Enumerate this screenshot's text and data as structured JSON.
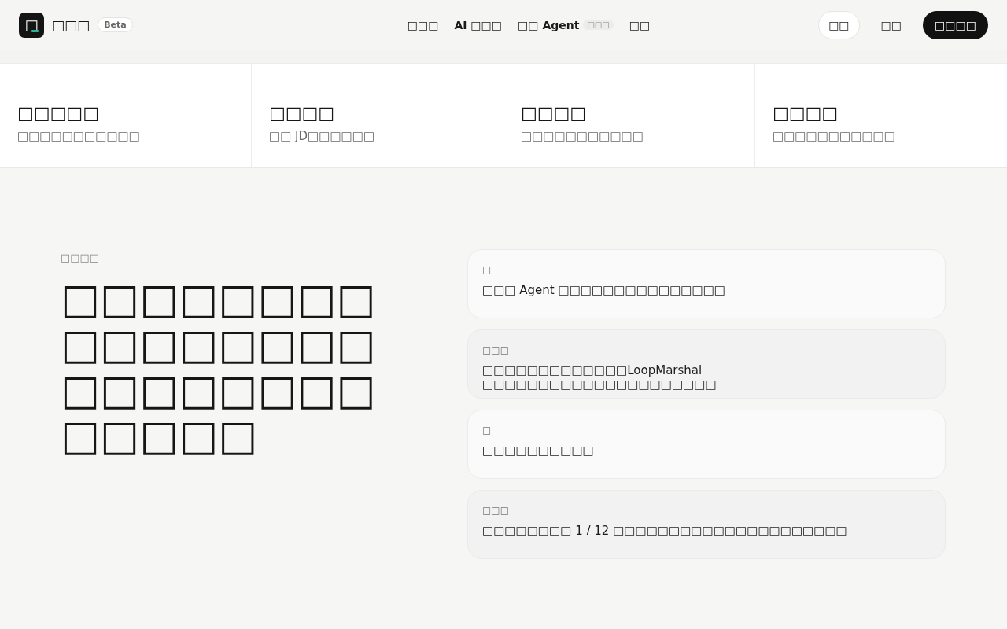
{
  "header": {
    "logo_mark": "□",
    "brand": "□□□",
    "badge": "Beta",
    "nav": [
      {
        "label": "□□□"
      },
      {
        "label": "AI □□□"
      },
      {
        "label": "□□ Agent",
        "badge": "□□□"
      },
      {
        "label": "□□"
      }
    ],
    "actions": [
      {
        "label": "□□",
        "kind": "outline"
      },
      {
        "label": "□□",
        "kind": "text"
      },
      {
        "label": "□□□□",
        "kind": "primary"
      }
    ]
  },
  "features": [
    {
      "title": "□□□□□",
      "subtitle": "□□□□□□□□□□□"
    },
    {
      "title": "□□□□",
      "subtitle": "□□ JD□□□□□□"
    },
    {
      "title": "□□□□",
      "subtitle": "□□□□□□□□□□□"
    },
    {
      "title": "□□□□",
      "subtitle": "□□□□□□□□□□□"
    }
  ],
  "hero": {
    "eyebrow": "□□□□",
    "headline": "□□□□□□□□□□□□□□□□□□□□□□□□□□□□□"
  },
  "conversation": [
    {
      "kind": "light",
      "speaker": "□",
      "text": "□□□ Agent □□□□□□□□□□□□□□□"
    },
    {
      "kind": "shaded",
      "speaker": "□□□",
      "text": "□□□□□□□□□□□□□LoopMarshal □□□□□□□□□□□□□□□□□□□□□"
    },
    {
      "kind": "light",
      "speaker": "□",
      "text": "□□□□□□□□□□"
    },
    {
      "kind": "shaded",
      "speaker": "□□□",
      "text": "□□□□□□□□ 1 / 12 □□□□□□□□□□□□□□□□□□□□□"
    }
  ]
}
